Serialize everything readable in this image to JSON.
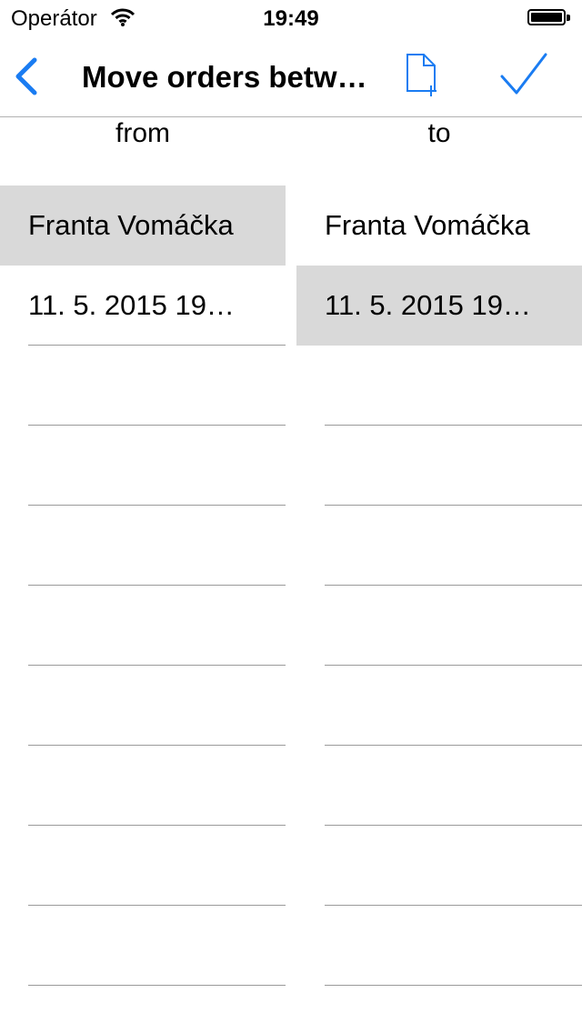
{
  "status_bar": {
    "carrier": "Operátor",
    "time": "19:49",
    "wifi_icon": "wifi-icon",
    "battery_icon": "battery-icon",
    "battery_level": 1.0
  },
  "nav": {
    "title": "Move orders betw…",
    "back_icon": "chevron-left-icon",
    "new_doc_icon": "new-document-icon",
    "done_icon": "checkmark-icon",
    "tint_color": "#1a7cf2"
  },
  "columns": {
    "from": {
      "header": "from",
      "rows": [
        {
          "label": "Franta Vomáčka",
          "selected": true
        },
        {
          "label": "11. 5. 2015 19…",
          "selected": false
        },
        {
          "label": "",
          "selected": false
        },
        {
          "label": "",
          "selected": false
        },
        {
          "label": "",
          "selected": false
        },
        {
          "label": "",
          "selected": false
        },
        {
          "label": "",
          "selected": false
        },
        {
          "label": "",
          "selected": false
        },
        {
          "label": "",
          "selected": false
        },
        {
          "label": "",
          "selected": false
        }
      ]
    },
    "to": {
      "header": "to",
      "rows": [
        {
          "label": "Franta Vomáčka",
          "selected": false
        },
        {
          "label": "11. 5. 2015 19…",
          "selected": true
        },
        {
          "label": "",
          "selected": false
        },
        {
          "label": "",
          "selected": false
        },
        {
          "label": "",
          "selected": false
        },
        {
          "label": "",
          "selected": false
        },
        {
          "label": "",
          "selected": false
        },
        {
          "label": "",
          "selected": false
        },
        {
          "label": "",
          "selected": false
        },
        {
          "label": "",
          "selected": false
        }
      ]
    }
  },
  "colors": {
    "selected_row": "#d9d9d9",
    "separator": "#9a9a9a"
  }
}
